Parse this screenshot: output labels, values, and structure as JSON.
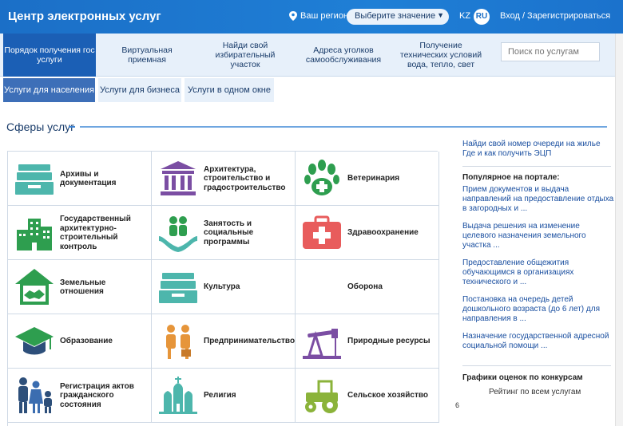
{
  "header": {
    "brand": "Центр электронных услуг",
    "region_label": "Ваш регион",
    "region_select": "Выберите значение",
    "lang_kz": "KZ",
    "lang_ru": "RU",
    "login": "Вход / Зарегистрироваться"
  },
  "nav": {
    "items": [
      {
        "label": "Порядок получения гос услуги"
      },
      {
        "label": "Виртуальная приемная"
      },
      {
        "label": "Найди свой избирательный участок"
      },
      {
        "label": "Адреса уголков самообслуживания"
      },
      {
        "label": "Получение технических условий вода, тепло, свет"
      }
    ],
    "search_placeholder": "Поиск по услугам"
  },
  "tabs": [
    {
      "label": "Услуги для населения"
    },
    {
      "label": "Услуги для бизнеса"
    },
    {
      "label": "Услуги в одном окне"
    }
  ],
  "section_title": "Сферы услуг",
  "categories": [
    {
      "label": "Архивы и документация",
      "icon": "archive-icon"
    },
    {
      "label": "Архитектура, строительство и градостроительство",
      "icon": "building-columns-icon"
    },
    {
      "label": "Ветеринария",
      "icon": "paw-icon"
    },
    {
      "label": "Государственный архитектурно-строительный контроль",
      "icon": "city-buildings-icon"
    },
    {
      "label": "Занятость и социальные программы",
      "icon": "people-hands-icon"
    },
    {
      "label": "Здравоохранение",
      "icon": "first-aid-icon"
    },
    {
      "label": "Земельные отношения",
      "icon": "handshake-house-icon"
    },
    {
      "label": "Культура",
      "icon": "archive-icon"
    },
    {
      "label": "Оборона",
      "icon": ""
    },
    {
      "label": "Образование",
      "icon": "graduation-cap-icon"
    },
    {
      "label": "Предпринимательство",
      "icon": "business-people-icon"
    },
    {
      "label": "Природные ресурсы",
      "icon": "oil-pump-icon"
    },
    {
      "label": "Регистрация актов гражданского состояния",
      "icon": "family-icon"
    },
    {
      "label": "Религия",
      "icon": "church-icon"
    },
    {
      "label": "Сельское хозяйство",
      "icon": "tractor-icon"
    }
  ],
  "sidebar": {
    "top_link": "Найди свой номер очереди на жилье Где и как получить ЭЦП",
    "popular_title": "Популярное на портале:",
    "popular": [
      "Прием документов и выдача направлений на предоставление отдыха в загородных и ...",
      "Выдача решения на изменение целевого назначения земельного участка ...",
      "Предоставление общежития обучающимся в организациях технического и ...",
      "Постановка на очередь детей дошкольного возраста (до 6 лет) для направления в ...",
      "Назначение государственной адресной социальной помощи ..."
    ],
    "graphs_title": "Графики оценок по конкурсам",
    "rating_title": "Рейтинг по всем услугам",
    "axis_value": "6"
  },
  "colors": {
    "header_blue": "#1f7fd6",
    "nav_active": "#1b5fb5",
    "teal": "#4db6ac",
    "green": "#2e9e4f",
    "purple": "#7b4ea3",
    "red": "#e85c5c",
    "navy": "#2d4f7a",
    "orange": "#e6953a",
    "olive": "#8bb33a"
  }
}
